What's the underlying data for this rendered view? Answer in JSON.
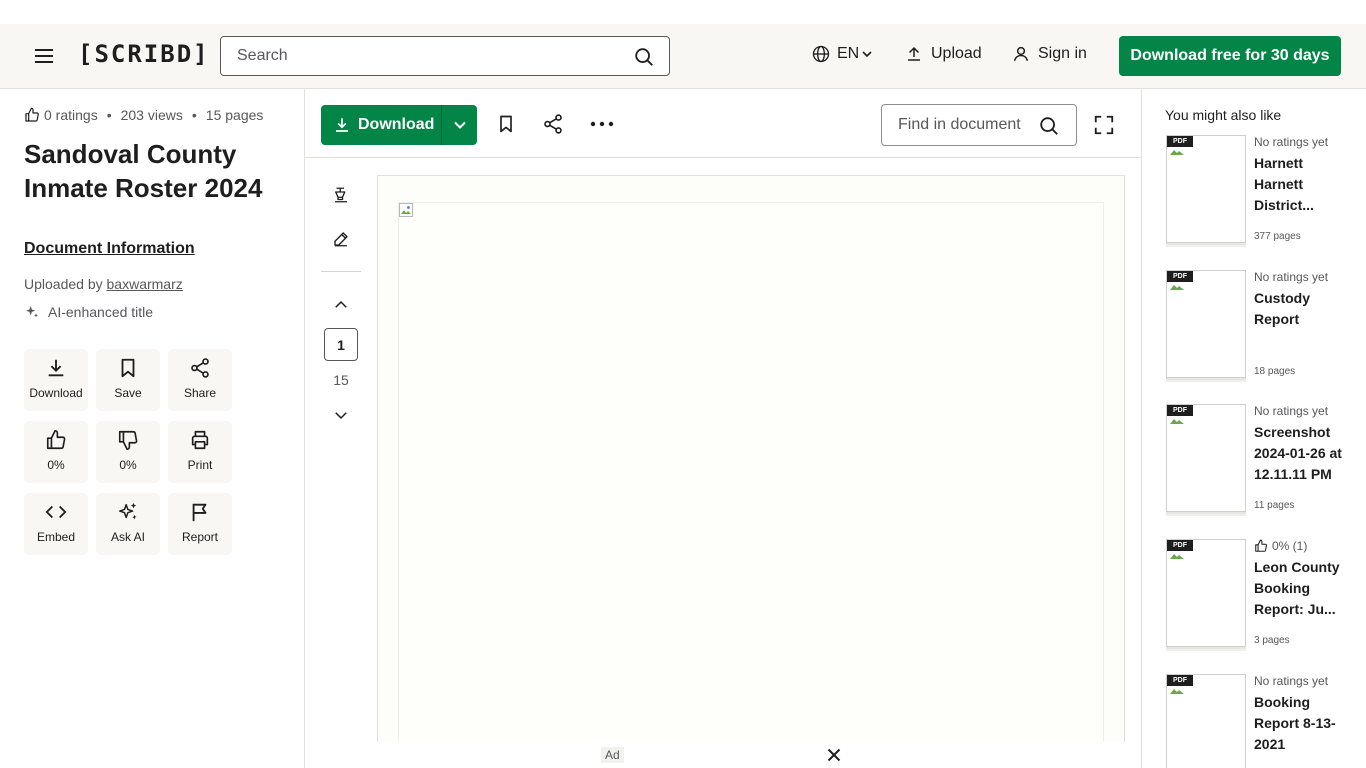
{
  "header": {
    "logo": "[SCRIBD]",
    "search_placeholder": "Search",
    "language": "EN",
    "upload_label": "Upload",
    "signin_label": "Sign in",
    "cta_label": "Download free for 30 days"
  },
  "document": {
    "ratings": "0 ratings",
    "views": "203 views",
    "pages": "15 pages",
    "title": "Sandoval County Inmate Roster 2024",
    "info_label": "Document Information",
    "uploaded_by_prefix": "Uploaded by",
    "uploader": "baxwarmarz",
    "ai_enhanced": "AI-enhanced title",
    "actions": [
      {
        "label": "Download",
        "icon": "download-icon"
      },
      {
        "label": "Save",
        "icon": "bookmark-icon"
      },
      {
        "label": "Share",
        "icon": "share-icon"
      },
      {
        "label": "0%",
        "icon": "thumbs-up-icon"
      },
      {
        "label": "0%",
        "icon": "thumbs-down-icon"
      },
      {
        "label": "Print",
        "icon": "print-icon"
      },
      {
        "label": "Embed",
        "icon": "code-icon"
      },
      {
        "label": "Ask AI",
        "icon": "sparkle-icon"
      },
      {
        "label": "Report",
        "icon": "flag-icon"
      }
    ]
  },
  "toolbar": {
    "download_label": "Download",
    "find_placeholder": "Find in document"
  },
  "viewer": {
    "current_page": "1",
    "total_pages": "15"
  },
  "ad": {
    "label": "Ad"
  },
  "recommendations": {
    "heading": "You might also like",
    "pdf_tag": "PDF",
    "items": [
      {
        "rating": "No ratings yet",
        "title": "Harnett Harnett District...",
        "pages": "377 pages"
      },
      {
        "rating": "No ratings yet",
        "title": "Custody Report",
        "pages": "18 pages"
      },
      {
        "rating": "No ratings yet",
        "title": "Screenshot 2024-01-26 at 12.11.11 PM",
        "pages": "11 pages"
      },
      {
        "rating": "0% (1)",
        "title": "Leon County Booking Report: Ju...",
        "pages": "3 pages"
      },
      {
        "rating": "No ratings yet",
        "title": "Booking Report 8-13-2021",
        "pages": ""
      }
    ]
  },
  "colors": {
    "brand_green": "#028546",
    "header_bg": "#f8f7f4",
    "text": "#1e1e1e",
    "muted_text": "#57575c"
  }
}
